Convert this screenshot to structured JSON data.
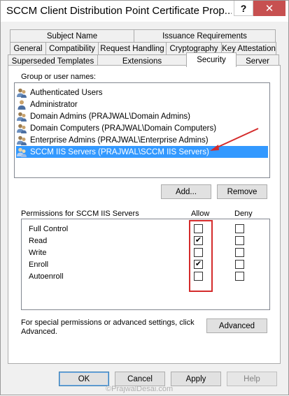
{
  "window": {
    "title": "SCCM Client Distribution Point Certificate Prop...",
    "help_label": "?",
    "close_label": "✕"
  },
  "tabs": {
    "row1": [
      "Subject Name",
      "Issuance Requirements"
    ],
    "row2": [
      "General",
      "Compatibility",
      "Request Handling",
      "Cryptography",
      "Key Attestation"
    ],
    "row3": [
      "Superseded Templates",
      "Extensions",
      "Security",
      "Server"
    ],
    "active": "Security"
  },
  "security": {
    "group_label": "Group or user names:",
    "users": [
      {
        "name": "Authenticated Users",
        "icon": "users-group-icon"
      },
      {
        "name": "Administrator",
        "icon": "user-icon"
      },
      {
        "name": "Domain Admins (PRAJWAL\\Domain Admins)",
        "icon": "users-group-icon"
      },
      {
        "name": "Domain Computers (PRAJWAL\\Domain Computers)",
        "icon": "users-group-icon"
      },
      {
        "name": "Enterprise Admins (PRAJWAL\\Enterprise Admins)",
        "icon": "users-group-icon"
      },
      {
        "name": "SCCM IIS Servers (PRAJWAL\\SCCM IIS Servers)",
        "icon": "users-group-icon",
        "selected": true
      }
    ],
    "add_label": "Add...",
    "remove_label": "Remove",
    "permissions_label": "Permissions for SCCM IIS Servers",
    "allow_label": "Allow",
    "deny_label": "Deny",
    "permissions": [
      {
        "name": "Full Control",
        "allow": false,
        "deny": false
      },
      {
        "name": "Read",
        "allow": true,
        "deny": false
      },
      {
        "name": "Write",
        "allow": false,
        "deny": false
      },
      {
        "name": "Enroll",
        "allow": true,
        "deny": false
      },
      {
        "name": "Autoenroll",
        "allow": false,
        "deny": false
      }
    ],
    "special_text_1": "For special permissions or advanced settings, click",
    "special_text_2": "Advanced.",
    "advanced_label": "Advanced"
  },
  "footer": {
    "ok_label": "OK",
    "cancel_label": "Cancel",
    "apply_label": "Apply",
    "help_label": "Help"
  },
  "watermark": "©PrajwalDesai.com",
  "colors": {
    "selection": "#3399ff",
    "annotation": "#d42b2b"
  }
}
